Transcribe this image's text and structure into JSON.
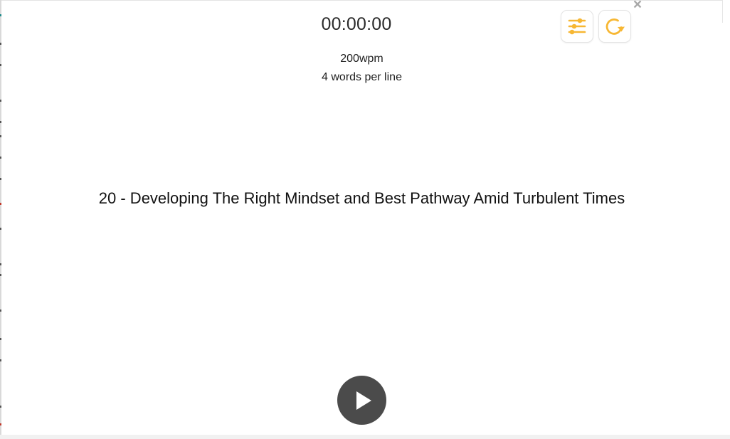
{
  "timer": "00:00:00",
  "settings": {
    "wpm": "200wpm",
    "words_per_line": "4 words per line"
  },
  "reading": {
    "text": "20 - Developing The Right Mindset and Best Pathway Amid Turbulent Times"
  },
  "toolbar": {
    "settings_icon": "sliders-icon",
    "restart_icon": "refresh-icon",
    "close_label": "×"
  },
  "controls": {
    "play_icon": "play-icon"
  },
  "colors": {
    "accent": "#f7b733",
    "play_bg": "#4b4b4b",
    "close": "#a8a8a8"
  }
}
